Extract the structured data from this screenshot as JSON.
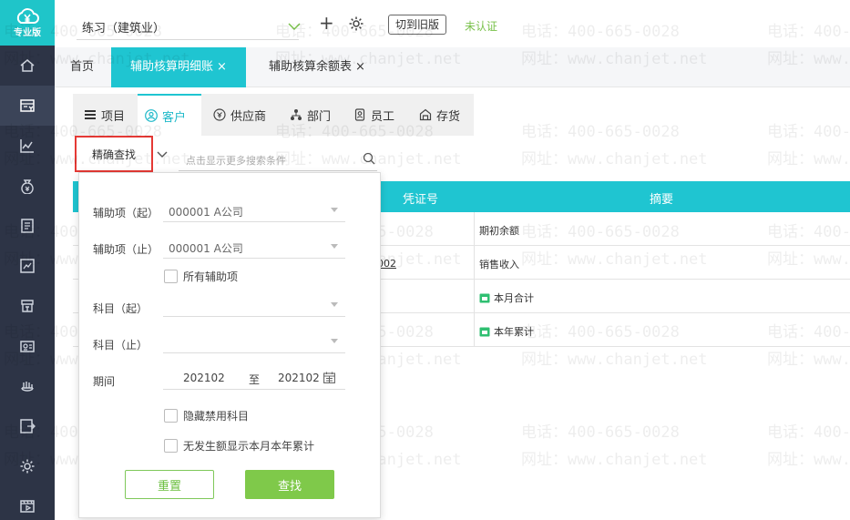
{
  "sidebar": {
    "logo_text": "专业版",
    "items": [
      {
        "icon": "home-icon"
      },
      {
        "icon": "voucher-icon",
        "active": true
      },
      {
        "icon": "chart-icon"
      },
      {
        "icon": "money-bag-icon"
      },
      {
        "icon": "ledger-icon"
      },
      {
        "icon": "report-icon"
      },
      {
        "icon": "register-icon"
      },
      {
        "icon": "payroll-icon"
      },
      {
        "icon": "hand-coin-icon"
      },
      {
        "icon": "export-icon"
      },
      {
        "icon": "gear-icon"
      },
      {
        "icon": "video-icon"
      }
    ]
  },
  "watermark": {
    "phone": "电话：400-665-0028",
    "site": "网址：www.chanjet.net"
  },
  "header": {
    "account_name": "练习（建筑业）",
    "switch_old_label": "切到旧版",
    "cert_status": "未认证",
    "plus_label": "+"
  },
  "tabs": [
    {
      "label": "首页"
    },
    {
      "label": "辅助核算明细账",
      "close": "×"
    },
    {
      "label": "辅助核算余额表",
      "close": "×"
    }
  ],
  "categories": [
    {
      "label": "项目",
      "icon": "list-icon"
    },
    {
      "label": "客户",
      "icon": "customer-icon"
    },
    {
      "label": "供应商",
      "icon": "supplier-icon"
    },
    {
      "label": "部门",
      "icon": "org-icon"
    },
    {
      "label": "员工",
      "icon": "employee-icon"
    },
    {
      "label": "存货",
      "icon": "inventory-icon"
    }
  ],
  "search": {
    "precise_label": "精确查找",
    "placeholder": "点击显示更多搜索条件"
  },
  "table": {
    "headers": {
      "voucher": "凭证号",
      "summary": "摘要"
    },
    "rows": [
      {
        "voucher": "",
        "summary": "期初余额"
      },
      {
        "voucher": "-002",
        "summary": "销售收入"
      },
      {
        "voucher": "",
        "summary": "本月合计"
      },
      {
        "voucher": "",
        "summary": "本年累计"
      }
    ]
  },
  "filter": {
    "aux_from_label": "辅助项（起）",
    "aux_from_value": "000001 A公司",
    "aux_to_label": "辅助项（止）",
    "aux_to_value": "000001 A公司",
    "all_aux_label": "所有辅助项",
    "subject_from_label": "科目（起）",
    "subject_to_label": "科目（止）",
    "period_label": "期间",
    "period_from": "202102",
    "period_sep": "至",
    "period_to": "202102",
    "hide_disabled_label": "隐藏禁用科目",
    "show_no_amount_label": "无发生额显示本月本年累计",
    "reset_label": "重置",
    "find_label": "查找"
  },
  "colors": {
    "accent": "#1fc5d1",
    "sidebar": "#2d3446",
    "green": "#7fc94a",
    "highlight": "#e53935"
  }
}
